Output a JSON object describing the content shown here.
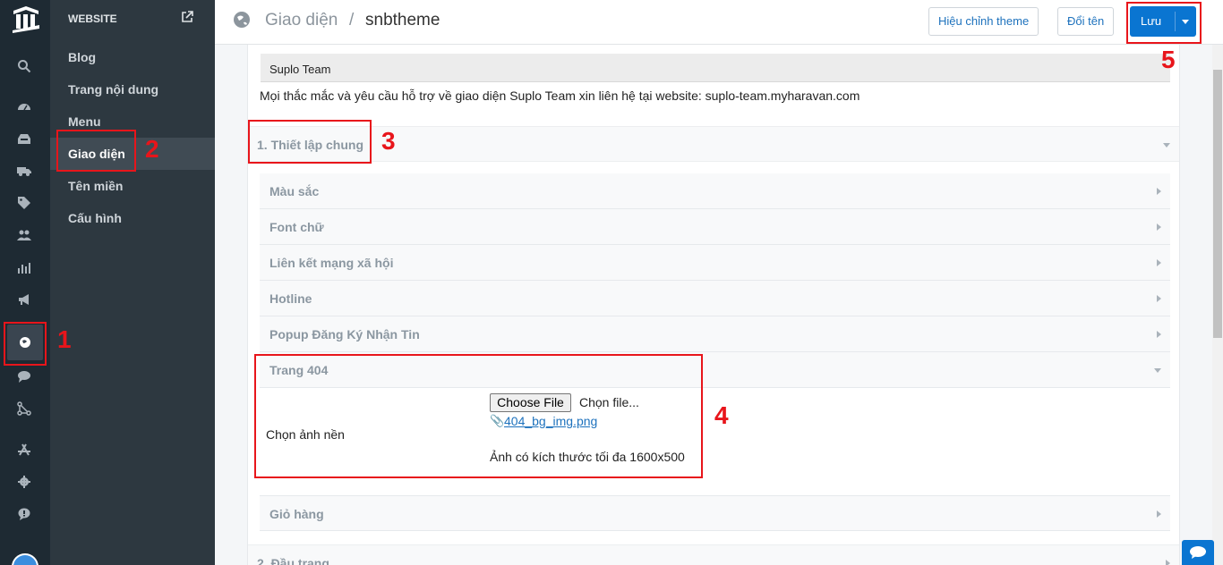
{
  "sidebar": {
    "section_title": "WEBSITE",
    "items": [
      {
        "label": "Blog"
      },
      {
        "label": "Trang nội dung"
      },
      {
        "label": "Menu"
      },
      {
        "label": "Giao diện"
      },
      {
        "label": "Tên miền"
      },
      {
        "label": "Cấu hình"
      }
    ],
    "active_item": "Giao diện"
  },
  "header": {
    "breadcrumb_parent": "Giao diện",
    "separator": "/",
    "breadcrumb_current": "snbtheme",
    "edit_theme_label": "Hiệu chỉnh theme",
    "rename_label": "Đổi tên",
    "save_label": "Lưu"
  },
  "main": {
    "author_title": "Suplo Team",
    "support_text": "Mọi thắc mắc và yêu cầu hỗ trợ về giao diện Suplo Team xin liên hệ tại website: suplo-team.myharavan.com",
    "section1_title": "1. Thiết lập chung",
    "rows": [
      {
        "label": "Màu sắc"
      },
      {
        "label": "Font chữ"
      },
      {
        "label": "Liên kết mạng xã hội"
      },
      {
        "label": "Hotline"
      },
      {
        "label": "Popup Đăng Ký Nhận Tin"
      },
      {
        "label": "Trang 404"
      }
    ],
    "page404": {
      "bg_label": "Chọn ảnh nền",
      "choose_button": "Choose File",
      "file_status": "Chọn file...",
      "file_name": "404_bg_img.png",
      "size_hint": "Ảnh có kích thước tối đa 1600x500"
    },
    "cart_label": "Giỏ hàng",
    "section2_title": "2. Đầu trang"
  },
  "annotations": [
    "1",
    "2",
    "3",
    "4",
    "5"
  ],
  "colors": {
    "annotation": "#e8151b",
    "primary": "#0a75d1",
    "sidebar_dark": "#1e2a33",
    "subnav": "#2d3840"
  }
}
